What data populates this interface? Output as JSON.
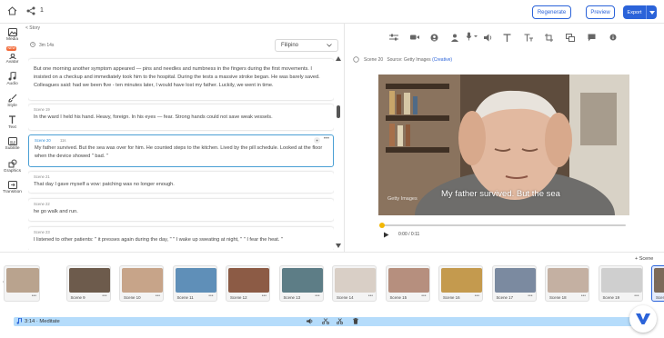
{
  "header": {
    "page_number": "1",
    "regenerate_label": "Regenerate",
    "preview_label": "Preview",
    "export_label": "Export"
  },
  "sidebar": {
    "items": [
      {
        "label": "Media",
        "icon": "media-icon"
      },
      {
        "label": "Avatar",
        "icon": "avatar-icon",
        "badge": "NEW"
      },
      {
        "label": "Audio",
        "icon": "music-icon"
      },
      {
        "label": "Style",
        "icon": "brush-icon"
      },
      {
        "label": "Text",
        "icon": "text-icon"
      },
      {
        "label": "Subtitle",
        "icon": "subtitle-icon"
      },
      {
        "label": "Graphics",
        "icon": "graphics-icon"
      },
      {
        "label": "Transition",
        "icon": "transition-icon"
      }
    ]
  },
  "script": {
    "back_label": "< Story",
    "duration": "3m 14s",
    "language": "Filipino",
    "scenes": [
      {
        "label": "",
        "text": "But one morning another symptom appeared — pins and needles and numbness in the fingers during the first movements. I insisted on a checkup and immediately took him to the hospital. During the tests a massive stroke began. He was barely saved. Colleagues said: had we been five - ten minutes later, I would have lost my father. Luckily, we went in time."
      },
      {
        "label": "Scene 19",
        "text": "In the ward I held his hand. Heavy, foreign. In his eyes — fear. Strong hands could not save weak vessels."
      },
      {
        "label": "Scene 20",
        "duration": "11s",
        "text": "My father survived. But the sea was over for him. He counted steps to the kitchen. Lived by the pill schedule. Looked at the floor when the device showed \" bad. \""
      },
      {
        "label": "Scene 21",
        "text": "That day I gave myself a vow: patching was no longer enough."
      },
      {
        "label": "Scene 22",
        "text": "he go walk and run."
      },
      {
        "label": "Scene 23",
        "text": "I listened to other patients: \" it presses again during the day, \" \" I wake up sweating at night, \" \" I fear the heat. \""
      }
    ]
  },
  "preview": {
    "scene_label": "Scene 20",
    "source_label": "Source: Getty Images",
    "source_tag": "(Creative)",
    "caption": "My father survived. But the sea",
    "watermark": "Getty Images",
    "time": "0:00 / 0:11",
    "progress": 0.0
  },
  "timeline": {
    "add_scene_label": "+ Scene",
    "thumbnails": [
      {
        "label": "",
        "color": "#b9a38e"
      },
      {
        "label": "Scene 9",
        "color": "#6d5b4c"
      },
      {
        "label": "Scene 10",
        "color": "#c7a489"
      },
      {
        "label": "Scene 11",
        "color": "#5f8fb8"
      },
      {
        "label": "Scene 12",
        "color": "#8c5b45"
      },
      {
        "label": "Scene 13",
        "color": "#5d7d86"
      },
      {
        "label": "Scene 14",
        "color": "#d9cfc6"
      },
      {
        "label": "Scene 15",
        "color": "#b68f7e"
      },
      {
        "label": "Scene 16",
        "color": "#c49a4e"
      },
      {
        "label": "Scene 17",
        "color": "#7b8aa0"
      },
      {
        "label": "Scene 18",
        "color": "#c4b0a2"
      },
      {
        "label": "Scene 19",
        "color": "#cfcfcf"
      },
      {
        "label": "Scene 20",
        "color": "#7c6a5a"
      }
    ],
    "audio_label": "3:14 · Meditate"
  },
  "colors": {
    "accent": "#2b63d9",
    "active_card": "#4a9fd4",
    "progress": "#f2b705",
    "audio_track": "#b5dcfb"
  }
}
